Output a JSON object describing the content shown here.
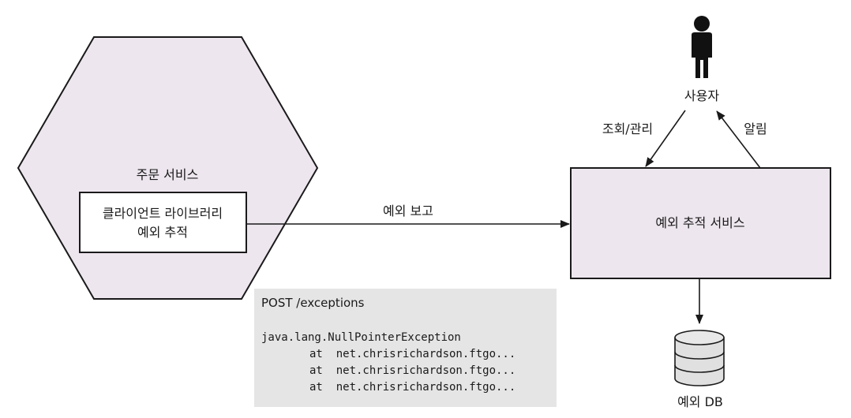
{
  "order_service": {
    "title": "주문 서비스",
    "library_line1": "클라이언트 라이브러리",
    "library_line2": "예외 추적"
  },
  "exception_tracking_service": {
    "title": "예외 추적 서비스"
  },
  "user": {
    "label": "사용자"
  },
  "edges": {
    "report": "예외 보고",
    "query_manage": "조회/관리",
    "notify": "알림"
  },
  "database": {
    "label": "예외 DB"
  },
  "code_sample": {
    "request": "POST /exceptions",
    "exception": "java.lang.NullPointerException",
    "frames": [
      "at  net.chrisrichardson.ftgo...",
      "at  net.chrisrichardson.ftgo...",
      "at  net.chrisrichardson.ftgo..."
    ]
  },
  "colors": {
    "box_fill": "#ede6ee",
    "code_bg": "#e5e5e5",
    "stroke": "#1a1a1a"
  }
}
